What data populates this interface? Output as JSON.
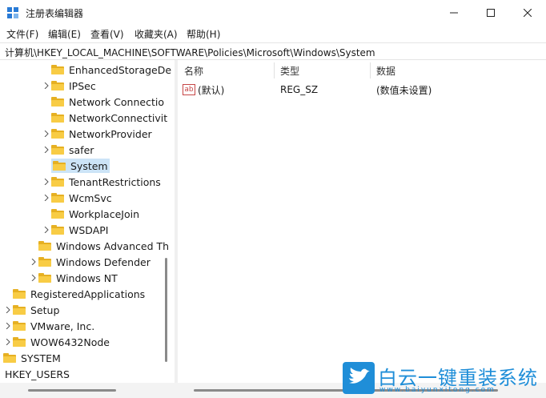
{
  "window": {
    "title": "注册表编辑器",
    "minimize_label": "─",
    "maximize_label": "☐",
    "close_label": "✕"
  },
  "menu": {
    "items": [
      "文件(F)",
      "编辑(E)",
      "查看(V)",
      "收藏夹(A)",
      "帮助(H)"
    ]
  },
  "address": {
    "path": "计算机\\HKEY_LOCAL_MACHINE\\SOFTWARE\\Policies\\Microsoft\\Windows\\System"
  },
  "tree": {
    "items": [
      {
        "label": "EnhancedStorageDe",
        "expandable": false
      },
      {
        "label": "IPSec",
        "expandable": true
      },
      {
        "label": "Network Connectio",
        "expandable": false
      },
      {
        "label": "NetworkConnectivit",
        "expandable": false
      },
      {
        "label": "NetworkProvider",
        "expandable": true
      },
      {
        "label": "safer",
        "expandable": true
      },
      {
        "label": "System",
        "expandable": false,
        "selected": true
      },
      {
        "label": "TenantRestrictions",
        "expandable": true
      },
      {
        "label": "WcmSvc",
        "expandable": true
      },
      {
        "label": "WorkplaceJoin",
        "expandable": false
      },
      {
        "label": "WSDAPI",
        "expandable": true
      },
      {
        "label": "Windows Advanced Th",
        "expandable": false
      },
      {
        "label": "Windows Defender",
        "expandable": true
      },
      {
        "label": "Windows NT",
        "expandable": true
      },
      {
        "label": "RegisteredApplications",
        "expandable": false
      },
      {
        "label": "Setup",
        "expandable": true
      },
      {
        "label": "VMware, Inc.",
        "expandable": true
      },
      {
        "label": "WOW6432Node",
        "expandable": true
      },
      {
        "label": "SYSTEM",
        "expandable": false
      },
      {
        "label": "HKEY_USERS",
        "expandable": false
      }
    ]
  },
  "list": {
    "columns": [
      "名称",
      "类型",
      "数据"
    ],
    "rows": [
      {
        "name": "(默认)",
        "type": "REG_SZ",
        "data": "(数值未设置)"
      }
    ],
    "value_icon": "ab"
  },
  "watermark": {
    "text": "白云一键重装系统",
    "url": "www.baiyunxitong.com"
  },
  "colors": {
    "folder": "#f8cc45",
    "selection": "#cce4f7",
    "brand": "#1f8ed8"
  }
}
